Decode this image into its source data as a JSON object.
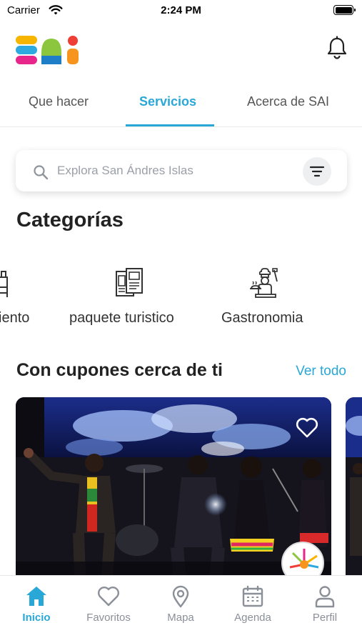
{
  "status_bar": {
    "carrier": "Carrier",
    "time": "2:24 PM"
  },
  "header": {
    "logo_text": "SAI"
  },
  "tabs": [
    {
      "label": "Que hacer",
      "active": false
    },
    {
      "label": "Servicios",
      "active": true
    },
    {
      "label": "Acerca de SAI",
      "active": false
    }
  ],
  "search": {
    "placeholder": "Explora San Ándres Islas",
    "value": ""
  },
  "categories": {
    "title": "Categorías",
    "items": [
      {
        "label": "iento",
        "icon": "hotel-bed-icon"
      },
      {
        "label": "paquete turistico",
        "icon": "brochure-icon"
      },
      {
        "label": "Gastronomia",
        "icon": "chef-icon"
      }
    ]
  },
  "coupons": {
    "title": "Con cupones cerca de ti",
    "see_all": "Ver todo"
  },
  "bottom_nav": [
    {
      "label": "Inicio",
      "icon": "home-icon",
      "active": true
    },
    {
      "label": "Favoritos",
      "icon": "heart-icon",
      "active": false
    },
    {
      "label": "Mapa",
      "icon": "map-pin-icon",
      "active": false
    },
    {
      "label": "Agenda",
      "icon": "calendar-icon",
      "active": false
    },
    {
      "label": "Perfil",
      "icon": "user-icon",
      "active": false
    }
  ],
  "colors": {
    "accent": "#29a7d6",
    "inactive": "#8a8f98",
    "text": "#222222"
  }
}
